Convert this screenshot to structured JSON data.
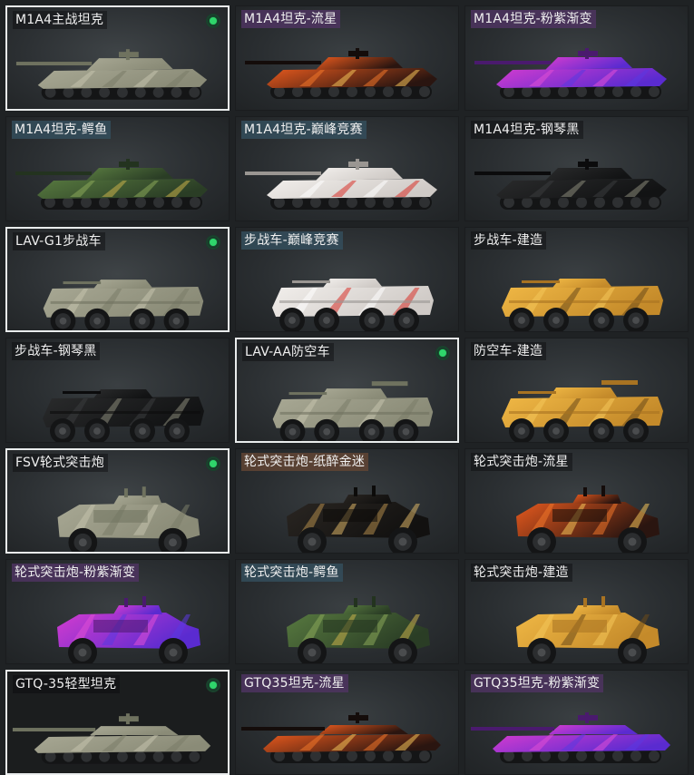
{
  "cards": [
    {
      "label": "M1A4主战坦克",
      "selected": true,
      "badge": true,
      "kind": "tank",
      "skin": "camo",
      "tag": "dark"
    },
    {
      "label": "M1A4坦克-流星",
      "selected": false,
      "badge": false,
      "kind": "tank",
      "skin": "meteor",
      "tag": "purple"
    },
    {
      "label": "M1A4坦克-粉紫渐变",
      "selected": false,
      "badge": false,
      "kind": "tank",
      "skin": "pinkpurple",
      "tag": "purple"
    },
    {
      "label": "M1A4坦克-鳄鱼",
      "selected": false,
      "badge": false,
      "kind": "tank",
      "skin": "croc",
      "tag": "teal"
    },
    {
      "label": "M1A4坦克-巅峰竞赛",
      "selected": false,
      "badge": false,
      "kind": "tank",
      "skin": "race",
      "tag": "teal"
    },
    {
      "label": "M1A4坦克-钢琴黑",
      "selected": false,
      "badge": false,
      "kind": "tank",
      "skin": "black",
      "tag": "dark"
    },
    {
      "label": "LAV-G1步战车",
      "selected": true,
      "badge": true,
      "kind": "ifv",
      "skin": "camo",
      "tag": "dark"
    },
    {
      "label": "步战车-巅峰竞赛",
      "selected": false,
      "badge": false,
      "kind": "ifv",
      "skin": "race",
      "tag": "teal"
    },
    {
      "label": "步战车-建造",
      "selected": false,
      "badge": false,
      "kind": "ifv",
      "skin": "yellow",
      "tag": "dark"
    },
    {
      "label": "步战车-钢琴黑",
      "selected": false,
      "badge": false,
      "kind": "ifv",
      "skin": "black",
      "tag": "dark"
    },
    {
      "label": "LAV-AA防空车",
      "selected": true,
      "badge": true,
      "kind": "aa",
      "skin": "camo",
      "tag": "dark"
    },
    {
      "label": "防空车-建造",
      "selected": false,
      "badge": false,
      "kind": "aa",
      "skin": "yellow",
      "tag": "dark"
    },
    {
      "label": "FSV轮式突击炮",
      "selected": true,
      "badge": true,
      "kind": "fsv",
      "skin": "camo",
      "tag": "dark"
    },
    {
      "label": "轮式突击炮-纸醉金迷",
      "selected": false,
      "badge": false,
      "kind": "fsv",
      "skin": "blackgold",
      "tag": "brown"
    },
    {
      "label": "轮式突击炮-流星",
      "selected": false,
      "badge": false,
      "kind": "fsv",
      "skin": "meteor",
      "tag": "dark"
    },
    {
      "label": "轮式突击炮-粉紫渐变",
      "selected": false,
      "badge": false,
      "kind": "fsv",
      "skin": "pinkpurple",
      "tag": "purple"
    },
    {
      "label": "轮式突击炮-鳄鱼",
      "selected": false,
      "badge": false,
      "kind": "fsv",
      "skin": "croc",
      "tag": "teal"
    },
    {
      "label": "轮式突击炮-建造",
      "selected": false,
      "badge": false,
      "kind": "fsv",
      "skin": "yellow",
      "tag": "dark"
    },
    {
      "label": "GTQ-35轻型坦克",
      "selected": true,
      "badge": true,
      "kind": "light",
      "skin": "camo",
      "tag": "dark"
    },
    {
      "label": "GTQ35坦克-流星",
      "selected": false,
      "badge": false,
      "kind": "light",
      "skin": "meteor",
      "tag": "purple"
    },
    {
      "label": "GTQ35坦克-粉紫渐变",
      "selected": false,
      "badge": false,
      "kind": "light",
      "skin": "pinkpurple",
      "tag": "purple"
    }
  ],
  "colors": {
    "badge_green": "#2fd66b",
    "selected_border": "#e9ecec",
    "background": "#1f2224"
  }
}
